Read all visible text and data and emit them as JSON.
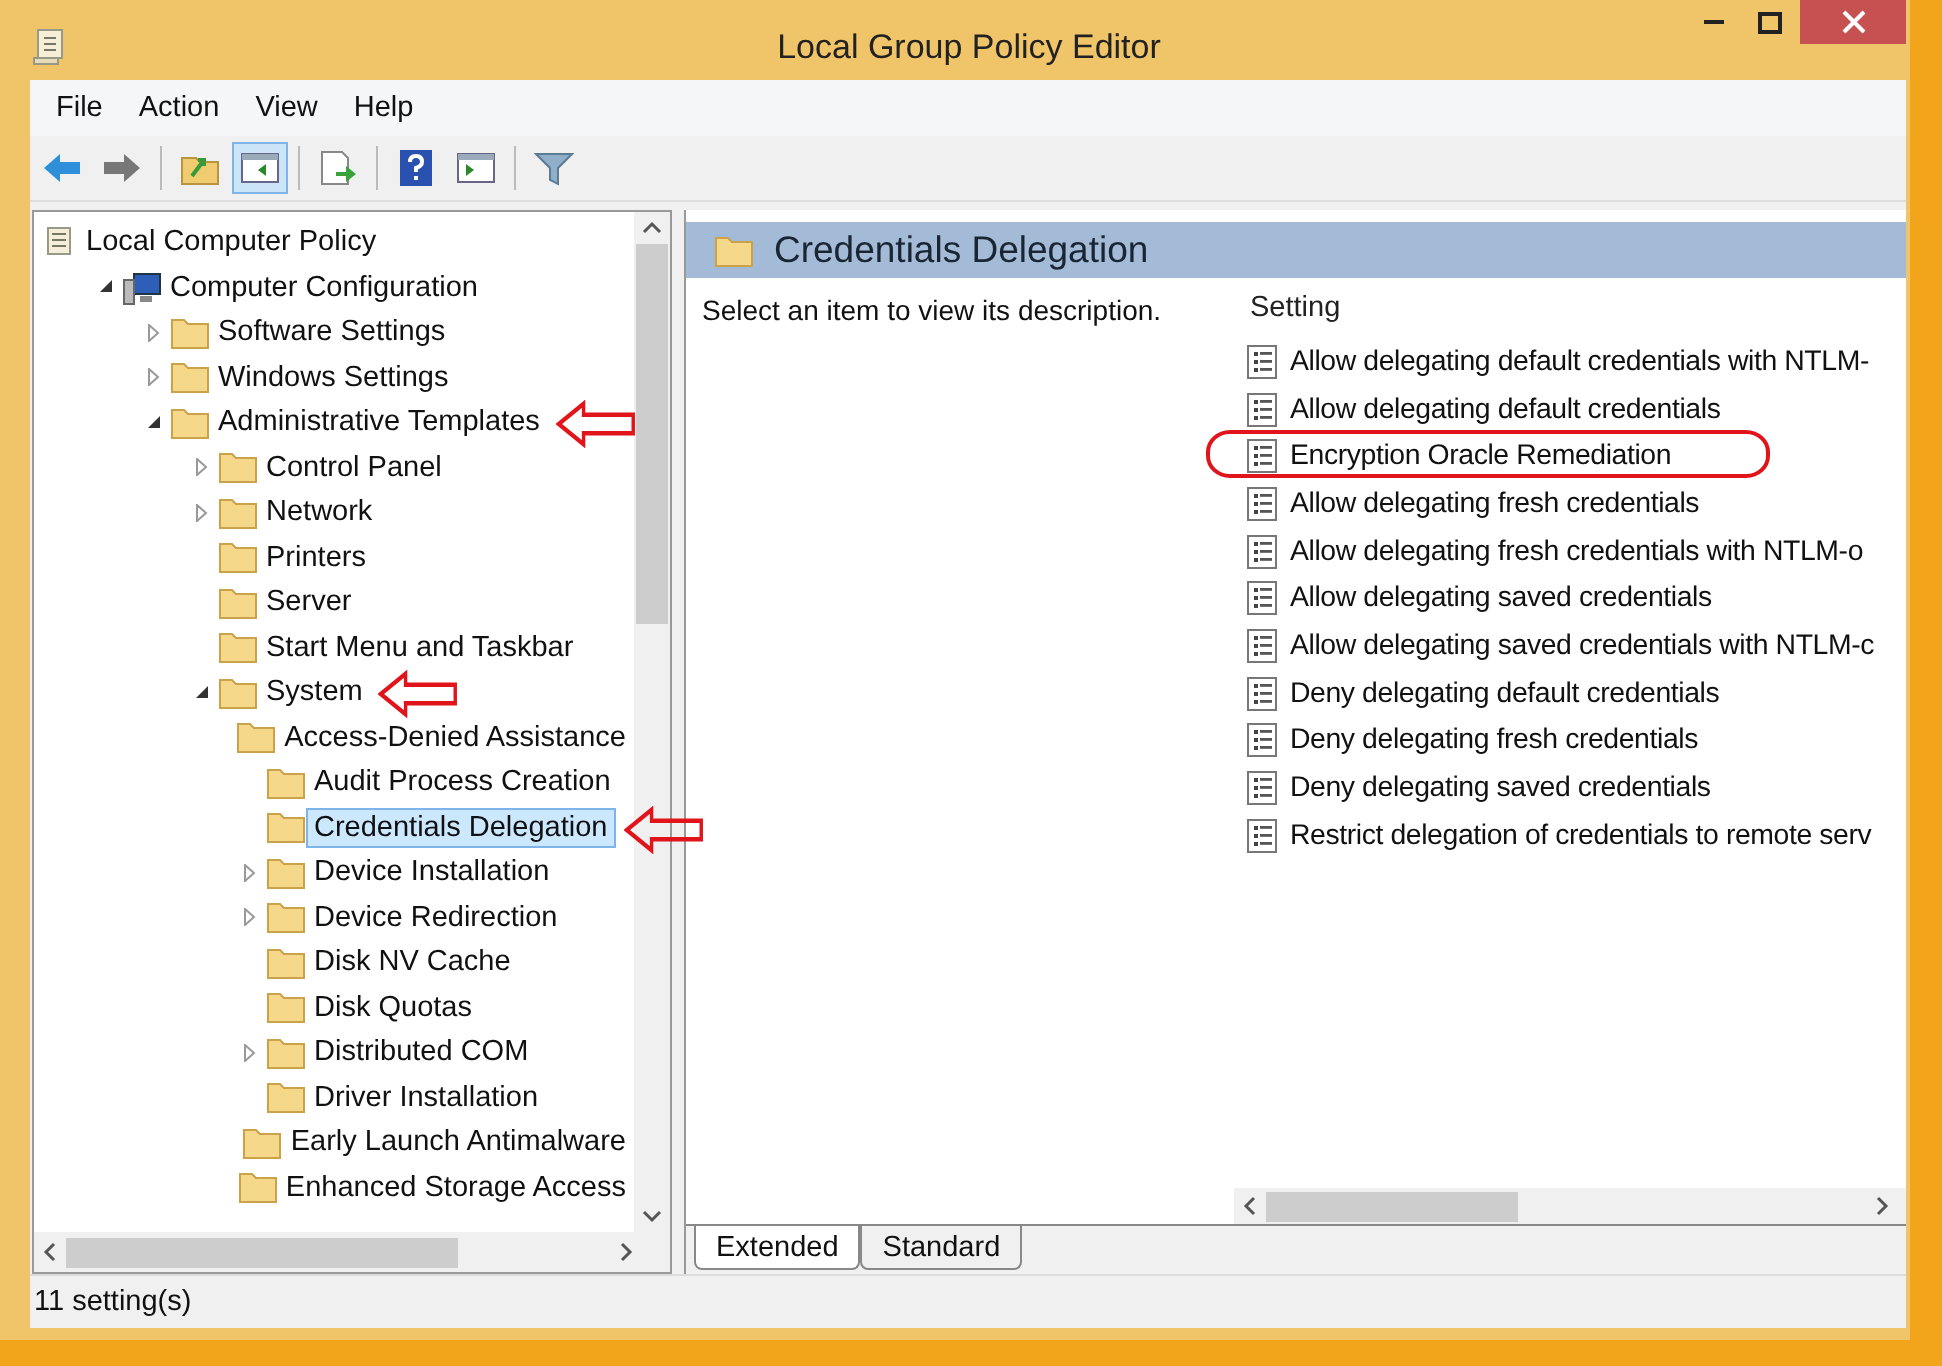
{
  "window": {
    "title": "Local Group Policy Editor"
  },
  "menu": [
    "File",
    "Action",
    "View",
    "Help"
  ],
  "toolbar": [
    {
      "kind": "back",
      "selected": false
    },
    {
      "kind": "forward",
      "selected": false
    },
    {
      "kind": "up",
      "selected": false
    },
    {
      "kind": "tree",
      "selected": true
    },
    {
      "kind": "export",
      "selected": false
    },
    {
      "kind": "help",
      "selected": false
    },
    {
      "kind": "pane",
      "selected": false
    },
    {
      "kind": "filter",
      "selected": false
    }
  ],
  "tree": [
    {
      "label": "Local Computer Policy",
      "kind": "root",
      "children": [
        {
          "label": "Computer Configuration",
          "kind": "computer",
          "expanded": true,
          "children": [
            {
              "label": "Software Settings",
              "kind": "folder",
              "expanded": false
            },
            {
              "label": "Windows Settings",
              "kind": "folder",
              "expanded": false
            },
            {
              "label": "Administrative Templates",
              "kind": "folder",
              "expanded": true,
              "annotated": true,
              "children": [
                {
                  "label": "Control Panel",
                  "kind": "folder",
                  "expanded": false
                },
                {
                  "label": "Network",
                  "kind": "folder",
                  "expanded": false
                },
                {
                  "label": "Printers",
                  "kind": "folder"
                },
                {
                  "label": "Server",
                  "kind": "folder"
                },
                {
                  "label": "Start Menu and Taskbar",
                  "kind": "folder"
                },
                {
                  "label": "System",
                  "kind": "folder",
                  "expanded": true,
                  "annotated": true,
                  "children": [
                    {
                      "label": "Access-Denied Assistance",
                      "kind": "folder"
                    },
                    {
                      "label": "Audit Process Creation",
                      "kind": "folder"
                    },
                    {
                      "label": "Credentials Delegation",
                      "kind": "folder",
                      "selected": true,
                      "annotated": true
                    },
                    {
                      "label": "Device Installation",
                      "kind": "folder",
                      "expanded": false
                    },
                    {
                      "label": "Device Redirection",
                      "kind": "folder",
                      "expanded": false
                    },
                    {
                      "label": "Disk NV Cache",
                      "kind": "folder"
                    },
                    {
                      "label": "Disk Quotas",
                      "kind": "folder"
                    },
                    {
                      "label": "Distributed COM",
                      "kind": "folder",
                      "expanded": false
                    },
                    {
                      "label": "Driver Installation",
                      "kind": "folder"
                    },
                    {
                      "label": "Early Launch Antimalware",
                      "kind": "folder"
                    },
                    {
                      "label": "Enhanced Storage Access",
                      "kind": "folder"
                    }
                  ]
                }
              ]
            }
          ]
        }
      ]
    }
  ],
  "pane": {
    "title": "Credentials Delegation",
    "description": "Select an item to view its description.",
    "column": "Setting",
    "settings": [
      {
        "label": "Allow delegating default credentials with NTLM-",
        "circled": false
      },
      {
        "label": "Allow delegating default credentials",
        "circled": false
      },
      {
        "label": "Encryption Oracle Remediation",
        "circled": true
      },
      {
        "label": "Allow delegating fresh credentials",
        "circled": false
      },
      {
        "label": "Allow delegating fresh credentials with NTLM-o",
        "circled": false
      },
      {
        "label": "Allow delegating saved credentials",
        "circled": false
      },
      {
        "label": "Allow delegating saved credentials with NTLM-c",
        "circled": false
      },
      {
        "label": "Deny delegating default credentials",
        "circled": false
      },
      {
        "label": "Deny delegating fresh credentials",
        "circled": false
      },
      {
        "label": "Deny delegating saved credentials",
        "circled": false
      },
      {
        "label": "Restrict delegation of credentials to remote serv",
        "circled": false
      }
    ],
    "tabs": [
      {
        "label": "Extended",
        "selected": true
      },
      {
        "label": "Standard",
        "selected": false
      }
    ]
  },
  "status_bar": "11 setting(s)"
}
